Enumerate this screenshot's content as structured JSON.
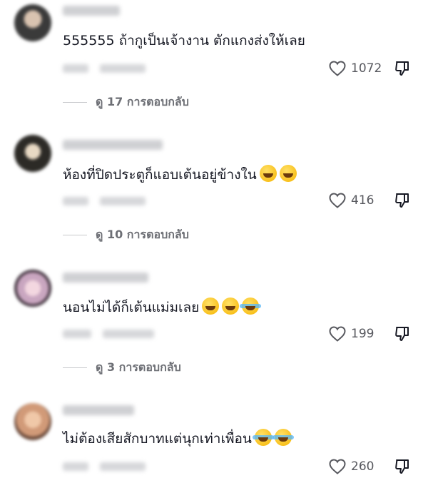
{
  "comments": [
    {
      "text": "555555 ถ้ากูเป็นเจ้างาน ตักแกงส่งให้เลย",
      "likes": "1072",
      "replies": "ดู 17 การตอบกลับ",
      "emojis": []
    },
    {
      "text": "ห้องที่ปิดประตูก็แอบเต้นอยู่ข้างใน",
      "likes": "416",
      "replies": "ดู 10 การตอบกลับ",
      "emojis": [
        "grinning-squint",
        "grinning-squint"
      ]
    },
    {
      "text": "นอนไม่ได้ก็เต้นแม่มเลย",
      "likes": "199",
      "replies": "ดู 3 การตอบกลับ",
      "emojis": [
        "grinning-sweat",
        "grinning-sweat",
        "tears-of-joy"
      ]
    },
    {
      "text": "ไม่ต้องเสียสักบาทแต่นุกเท่าเพื่อน",
      "likes": "260",
      "emojis": [
        "tears-of-joy",
        "tears-of-joy"
      ]
    }
  ],
  "icons": {
    "like": "heart-outline-icon",
    "dislike": "thumbs-down-icon"
  },
  "colors": {
    "text": "#161823",
    "secondary": "#57585e",
    "placeholder_blur": "#d6d7da"
  }
}
